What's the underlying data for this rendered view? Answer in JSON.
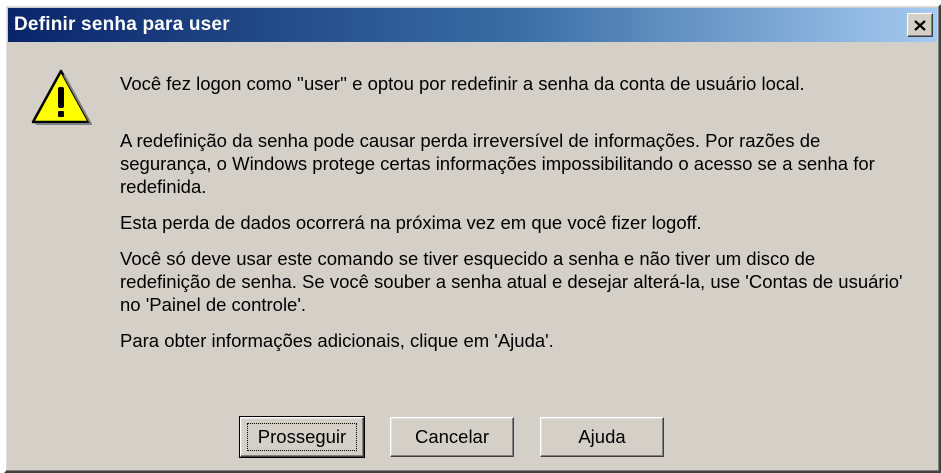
{
  "window": {
    "title": "Definir senha para user",
    "close_glyph": "✕"
  },
  "message": {
    "icon": "warning-icon",
    "paragraphs": [
      "Você fez logon como ''user'' e optou por redefinir a senha da conta de usuário local.",
      "A redefinição da senha pode causar perda irreversível de informações. Por razões de segurança, o Windows protege certas informações impossibilitando o acesso se a senha for redefinida.",
      "Esta perda de dados ocorrerá na próxima vez em que você fizer logoff.",
      "Você só deve usar este comando se tiver esquecido a senha e não tiver um disco de redefinição de senha. Se você souber a senha atual e desejar alterá-la, use 'Contas de usuário' no 'Painel de controle'.",
      "Para obter informações adicionais, clique em 'Ajuda'."
    ]
  },
  "buttons": {
    "proceed": "Prosseguir",
    "cancel": "Cancelar",
    "help": "Ajuda"
  },
  "colors": {
    "face": "#d4d0c8",
    "title_start": "#0a246a",
    "title_end": "#a6caf0",
    "warning_fill": "#ffff00"
  }
}
